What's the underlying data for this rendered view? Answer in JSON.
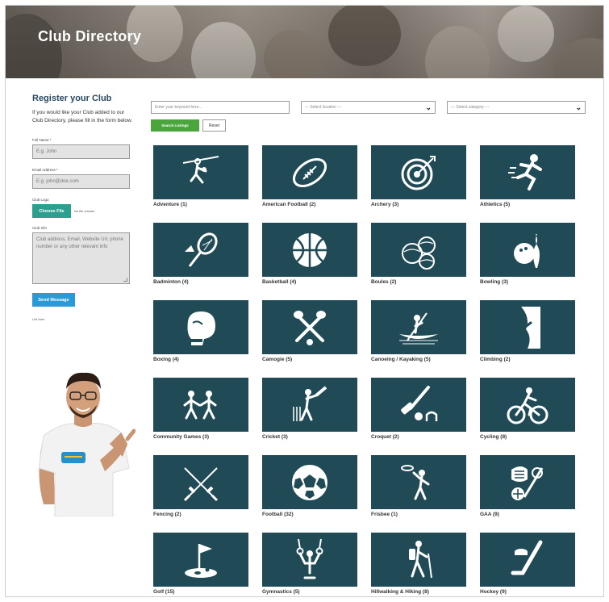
{
  "header": {
    "title": "Club Directory"
  },
  "sidebar": {
    "title": "Register your Club",
    "description": "If you would like your Club added to our Club Directory, please fill in the form below.",
    "full_name_label": "Full Name *",
    "full_name_placeholder": "E.g. John",
    "email_label": "Email Address *",
    "email_placeholder": "E.g. john@doe.com",
    "club_logo_label": "Club Logo",
    "choose_file_label": "Choose File",
    "no_file_text": "No file chosen",
    "club_info_label": "Club Info",
    "club_info_placeholder": "Club address, Email, Website Url, phone number or any other relevant info",
    "send_button": "Send Message",
    "list_form": "List form"
  },
  "search": {
    "keyword_placeholder": "Enter your keyword here...",
    "location_select": "--- Select location ---",
    "category_select": "--- Select category ---",
    "search_button": "Search Listings",
    "reset_button": "Reset"
  },
  "categories": [
    {
      "label": "Adventure (1)",
      "icon": "zipline-icon"
    },
    {
      "label": "American Football (2)",
      "icon": "american-football-icon"
    },
    {
      "label": "Archery (3)",
      "icon": "archery-target-icon"
    },
    {
      "label": "Athletics (5)",
      "icon": "runner-icon"
    },
    {
      "label": "Badminton (4)",
      "icon": "badminton-icon"
    },
    {
      "label": "Basketball (4)",
      "icon": "basketball-icon"
    },
    {
      "label": "Boules (2)",
      "icon": "boules-icon"
    },
    {
      "label": "Bowling (3)",
      "icon": "bowling-icon"
    },
    {
      "label": "Boxing (4)",
      "icon": "boxing-glove-icon"
    },
    {
      "label": "Camogie (5)",
      "icon": "camogie-icon"
    },
    {
      "label": "Canoeing / Kayaking (5)",
      "icon": "canoe-icon"
    },
    {
      "label": "Climbing (2)",
      "icon": "climbing-icon"
    },
    {
      "label": "Community Games (3)",
      "icon": "community-games-icon"
    },
    {
      "label": "Cricket (3)",
      "icon": "cricket-icon"
    },
    {
      "label": "Croquet (2)",
      "icon": "croquet-icon"
    },
    {
      "label": "Cycling (8)",
      "icon": "cycling-icon"
    },
    {
      "label": "Fencing (2)",
      "icon": "fencing-icon"
    },
    {
      "label": "Football (32)",
      "icon": "football-icon"
    },
    {
      "label": "Frisbee (1)",
      "icon": "frisbee-icon"
    },
    {
      "label": "GAA (9)",
      "icon": "gaa-icon"
    },
    {
      "label": "Golf (15)",
      "icon": "golf-icon"
    },
    {
      "label": "Gymnastics (5)",
      "icon": "gymnastics-rings-icon"
    },
    {
      "label": "Hillwalking & Hiking (8)",
      "icon": "hiker-icon"
    },
    {
      "label": "Hockey (9)",
      "icon": "hockey-icon"
    }
  ],
  "colors": {
    "tile": "#1f4a56",
    "search_button": "#4aa63c",
    "choose_file": "#2e9f8e",
    "send_button": "#2a9ad6",
    "heading": "#2a4a63"
  }
}
